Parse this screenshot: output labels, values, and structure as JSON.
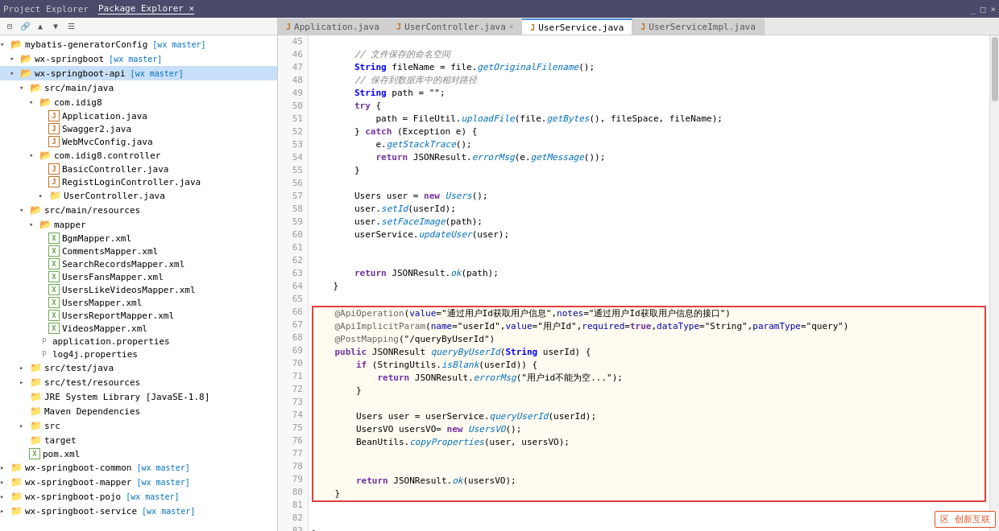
{
  "titleBar": {
    "tabs": [
      "Project Explorer",
      "Package Explorer"
    ],
    "activeTab": "Package Explorer",
    "controls": [
      "_",
      "□",
      "×"
    ]
  },
  "leftPanel": {
    "toolbarIcons": [
      "collapse",
      "link",
      "arrow-up",
      "arrow-down",
      "menu"
    ],
    "tree": [
      {
        "id": 1,
        "indent": 0,
        "type": "folder",
        "open": true,
        "label": "mybatis-generatorConfig",
        "badge": " [wx master]"
      },
      {
        "id": 2,
        "indent": 1,
        "type": "folder",
        "open": true,
        "label": "wx-springboot",
        "badge": " [wx master]"
      },
      {
        "id": 3,
        "indent": 1,
        "type": "folder-project",
        "open": true,
        "label": "wx-springboot-api",
        "badge": " [wx master]",
        "selected": true
      },
      {
        "id": 4,
        "indent": 2,
        "type": "folder",
        "open": true,
        "label": "src/main/java"
      },
      {
        "id": 5,
        "indent": 3,
        "type": "package",
        "open": true,
        "label": "com.idig8"
      },
      {
        "id": 6,
        "indent": 4,
        "type": "java",
        "label": "Application.java"
      },
      {
        "id": 7,
        "indent": 4,
        "type": "java",
        "label": "Swagger2.java"
      },
      {
        "id": 8,
        "indent": 4,
        "type": "java",
        "label": "WebMvcConfig.java"
      },
      {
        "id": 9,
        "indent": 3,
        "type": "package",
        "open": true,
        "label": "com.idig8.controller"
      },
      {
        "id": 10,
        "indent": 4,
        "type": "java",
        "label": "BasicController.java"
      },
      {
        "id": 11,
        "indent": 4,
        "type": "java",
        "label": "RegistLoginController.java"
      },
      {
        "id": 12,
        "indent": 4,
        "type": "package",
        "open": false,
        "label": "UserController.java"
      },
      {
        "id": 13,
        "indent": 2,
        "type": "folder",
        "open": true,
        "label": "src/main/resources"
      },
      {
        "id": 14,
        "indent": 3,
        "type": "folder",
        "open": true,
        "label": "mapper"
      },
      {
        "id": 15,
        "indent": 4,
        "type": "xml",
        "label": "BgmMapper.xml"
      },
      {
        "id": 16,
        "indent": 4,
        "type": "xml",
        "label": "CommentsMapper.xml"
      },
      {
        "id": 17,
        "indent": 4,
        "type": "xml",
        "label": "SearchRecordsMapper.xml"
      },
      {
        "id": 18,
        "indent": 4,
        "type": "xml",
        "label": "UsersFansMapper.xml"
      },
      {
        "id": 19,
        "indent": 4,
        "type": "xml",
        "label": "UsersLikeVideosMapper.xml"
      },
      {
        "id": 20,
        "indent": 4,
        "type": "xml",
        "label": "UsersMapper.xml"
      },
      {
        "id": 21,
        "indent": 4,
        "type": "xml",
        "label": "UsersReportMapper.xml"
      },
      {
        "id": 22,
        "indent": 4,
        "type": "xml",
        "label": "VideosMapper.xml"
      },
      {
        "id": 23,
        "indent": 3,
        "type": "props",
        "label": "application.properties"
      },
      {
        "id": 24,
        "indent": 3,
        "type": "props",
        "label": "log4j.properties"
      },
      {
        "id": 25,
        "indent": 2,
        "type": "folder",
        "open": false,
        "label": "src/test/java"
      },
      {
        "id": 26,
        "indent": 2,
        "type": "folder",
        "open": false,
        "label": "src/test/resources"
      },
      {
        "id": 27,
        "indent": 2,
        "type": "folder",
        "label": "JRE System Library [JavaSE-1.8]"
      },
      {
        "id": 28,
        "indent": 2,
        "type": "folder",
        "label": "Maven Dependencies"
      },
      {
        "id": 29,
        "indent": 2,
        "type": "folder",
        "open": false,
        "label": "src"
      },
      {
        "id": 30,
        "indent": 2,
        "type": "folder",
        "label": "target"
      },
      {
        "id": 31,
        "indent": 2,
        "type": "xml",
        "label": "pom.xml"
      },
      {
        "id": 32,
        "indent": 0,
        "type": "folder",
        "open": false,
        "label": "wx-springboot-common",
        "badge": " [wx master]"
      },
      {
        "id": 33,
        "indent": 0,
        "type": "folder",
        "open": false,
        "label": "wx-springboot-mapper",
        "badge": " [wx master]"
      },
      {
        "id": 34,
        "indent": 0,
        "type": "folder",
        "open": false,
        "label": "wx-springboot-pojo",
        "badge": " [wx master]"
      },
      {
        "id": 35,
        "indent": 0,
        "type": "folder",
        "open": false,
        "label": "wx-springboot-service",
        "badge": " [wx master]"
      }
    ]
  },
  "editorTabs": [
    {
      "label": "Application.java",
      "icon": "J",
      "active": false,
      "closable": false
    },
    {
      "label": "UserController.java",
      "icon": "J",
      "active": false,
      "closable": true
    },
    {
      "label": "UserService.java",
      "icon": "J",
      "active": false,
      "closable": false
    },
    {
      "label": "UserServiceImpl.java",
      "icon": "J",
      "active": false,
      "closable": false
    }
  ],
  "code": {
    "startLine": 45,
    "lines": [
      {
        "num": 45,
        "code": ""
      },
      {
        "num": 46,
        "code": "        // 文件保存的命名空间",
        "type": "comment"
      },
      {
        "num": 47,
        "code": "        String fileName = file.getOriginalFilename();",
        "type": "normal"
      },
      {
        "num": 48,
        "code": "        // 保存到数据库中的相对路径",
        "type": "comment"
      },
      {
        "num": 49,
        "code": "        String path = \"\";",
        "type": "normal"
      },
      {
        "num": 50,
        "code": "        try {",
        "type": "normal"
      },
      {
        "num": 51,
        "code": "            path = FileUtil.uploadFile(file.getBytes(), fileSpace, fileName);",
        "type": "normal"
      },
      {
        "num": 52,
        "code": "        } catch (Exception e) {",
        "type": "normal"
      },
      {
        "num": 53,
        "code": "            e.getStackTrace();",
        "type": "normal"
      },
      {
        "num": 54,
        "code": "            return JSONResult.errorMsg(e.getMessage());",
        "type": "normal"
      },
      {
        "num": 55,
        "code": "        }",
        "type": "normal"
      },
      {
        "num": 56,
        "code": ""
      },
      {
        "num": 57,
        "code": "        Users user = new Users();",
        "type": "normal"
      },
      {
        "num": 58,
        "code": "        user.setId(userId);",
        "type": "normal"
      },
      {
        "num": 59,
        "code": "        user.setFaceImage(path);",
        "type": "normal"
      },
      {
        "num": 60,
        "code": "        userService.updateUser(user);",
        "type": "normal"
      },
      {
        "num": 61,
        "code": ""
      },
      {
        "num": 62,
        "code": ""
      },
      {
        "num": 63,
        "code": "        return JSONResult.ok(path);",
        "type": "normal"
      },
      {
        "num": 64,
        "code": "    }",
        "type": "normal"
      },
      {
        "num": 65,
        "code": ""
      },
      {
        "num": 66,
        "code": "    @ApiOperation(value=\"通过用户Id获取用户信息\",notes=\"通过用户Id获取用户信息的接口\")",
        "type": "annotation",
        "highlight": true
      },
      {
        "num": 67,
        "code": "    @ApiImplicitParam(name=\"userId\",value=\"用户Id\",required=true,dataType=\"String\",paramType=\"query\")",
        "type": "annotation",
        "highlight": true
      },
      {
        "num": 68,
        "code": "    @PostMapping(\"/queryByUserId\")",
        "type": "annotation",
        "highlight": true
      },
      {
        "num": 69,
        "code": "    public JSONResult queryByUserId(String userId) {",
        "type": "normal",
        "highlight": true
      },
      {
        "num": 70,
        "code": "        if (StringUtils.isBlank(userId)) {",
        "type": "normal",
        "highlight": true
      },
      {
        "num": 71,
        "code": "            return JSONResult.errorMsg(\"用户id不能为空...\");",
        "type": "normal",
        "highlight": true
      },
      {
        "num": 72,
        "code": "        }",
        "type": "normal",
        "highlight": true
      },
      {
        "num": 73,
        "code": "",
        "highlight": true
      },
      {
        "num": 74,
        "code": "        Users user = userService.queryUserId(userId);",
        "type": "normal",
        "highlight": true
      },
      {
        "num": 75,
        "code": "        UsersVO usersVO= new UsersVO();",
        "type": "normal",
        "highlight": true
      },
      {
        "num": 76,
        "code": "        BeanUtils.copyProperties(user, usersVO);",
        "type": "normal",
        "highlight": true
      },
      {
        "num": 77,
        "code": "",
        "highlight": true
      },
      {
        "num": 78,
        "code": "",
        "highlight": true
      },
      {
        "num": 79,
        "code": "        return JSONResult.ok(usersVO);",
        "type": "normal",
        "highlight": true
      },
      {
        "num": 80,
        "code": "    }",
        "type": "normal",
        "highlight": true
      },
      {
        "num": 81,
        "code": ""
      },
      {
        "num": 82,
        "code": ""
      },
      {
        "num": 83,
        "code": "}",
        "type": "normal"
      }
    ]
  },
  "watermark": "区 创新互联"
}
